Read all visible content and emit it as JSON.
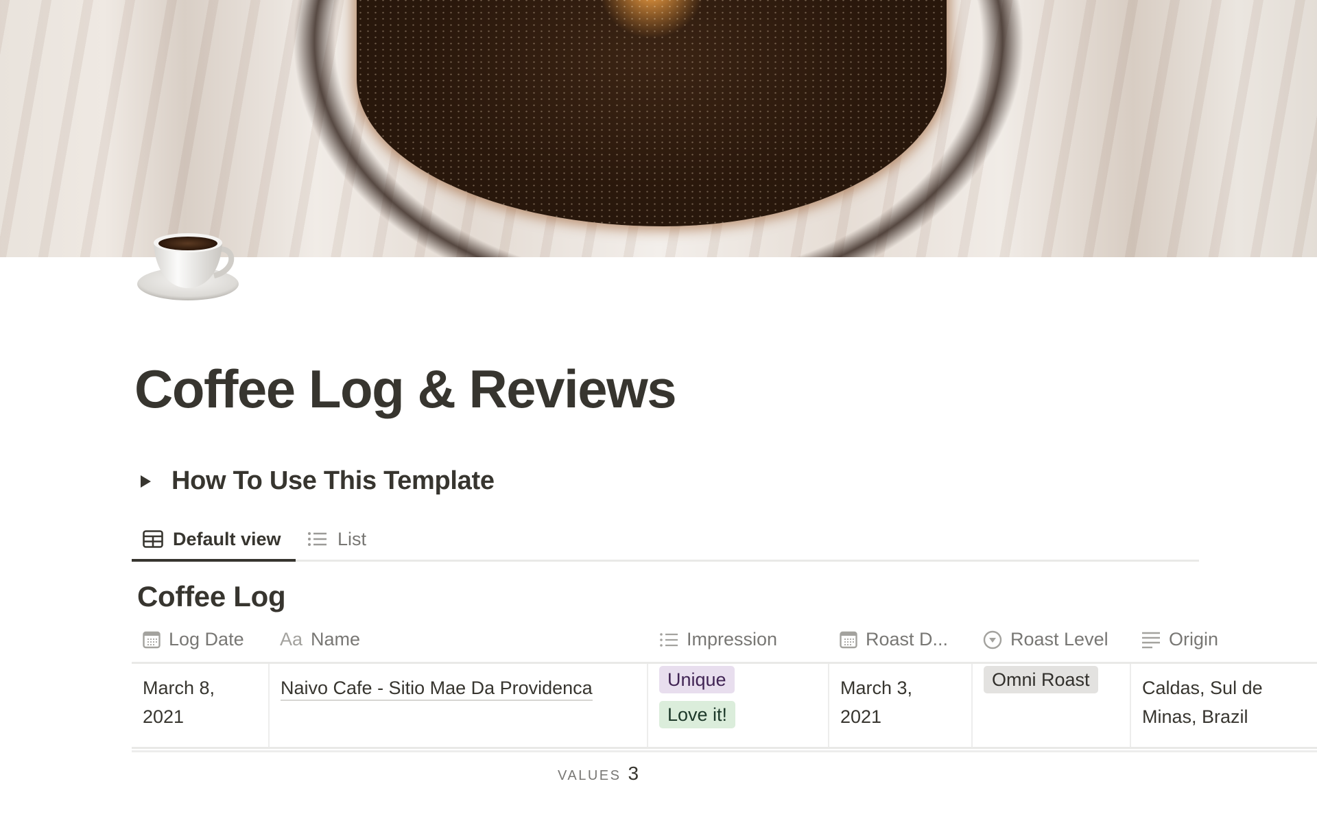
{
  "page": {
    "title": "Coffee Log & Reviews",
    "icon": "coffee-cup-icon",
    "cover": "coffee-pour-over-cover-photo"
  },
  "toggle": {
    "label": "How To Use This Template",
    "state": "collapsed"
  },
  "views": {
    "tabs": [
      {
        "label": "Default view",
        "icon": "table-icon",
        "active": true
      },
      {
        "label": "List",
        "icon": "list-icon",
        "active": false
      }
    ]
  },
  "database": {
    "title": "Coffee Log",
    "columns": [
      {
        "label": "Log Date",
        "icon": "calendar-icon"
      },
      {
        "label": "Name",
        "icon": "title-aa-icon"
      },
      {
        "label": "Impression",
        "icon": "multi-select-list-icon"
      },
      {
        "label": "Roast D...",
        "icon": "calendar-icon"
      },
      {
        "label": "Roast Level",
        "icon": "select-dropdown-icon"
      },
      {
        "label": "Origin",
        "icon": "text-lines-icon"
      }
    ],
    "rows": [
      {
        "log_date": "March 8, 2021",
        "log_date_l1": "March 8,",
        "log_date_l2": "2021",
        "name": "Naivo Cafe - Sitio Mae Da Providenca",
        "impression": [
          {
            "label": "Unique",
            "bg": "#e8deee",
            "fg": "#412454"
          },
          {
            "label": "Love it!",
            "bg": "#dbeddb",
            "fg": "#1c3829"
          }
        ],
        "roast_date": "March 3, 2021",
        "roast_date_l1": "March 3,",
        "roast_date_l2": "2021",
        "roast_level": {
          "label": "Omni Roast",
          "bg": "#e3e2e0",
          "fg": "#32302c"
        },
        "origin": "Caldas, Sul de Minas, Brazil",
        "origin_l1": "Caldas, Sul de",
        "origin_l2": "Minas, Brazil"
      }
    ],
    "calculation": {
      "label": "VALUES",
      "value": "3"
    }
  },
  "colors": {
    "text": "#37352f",
    "muted": "#787774",
    "divider": "#e9e9e7"
  }
}
